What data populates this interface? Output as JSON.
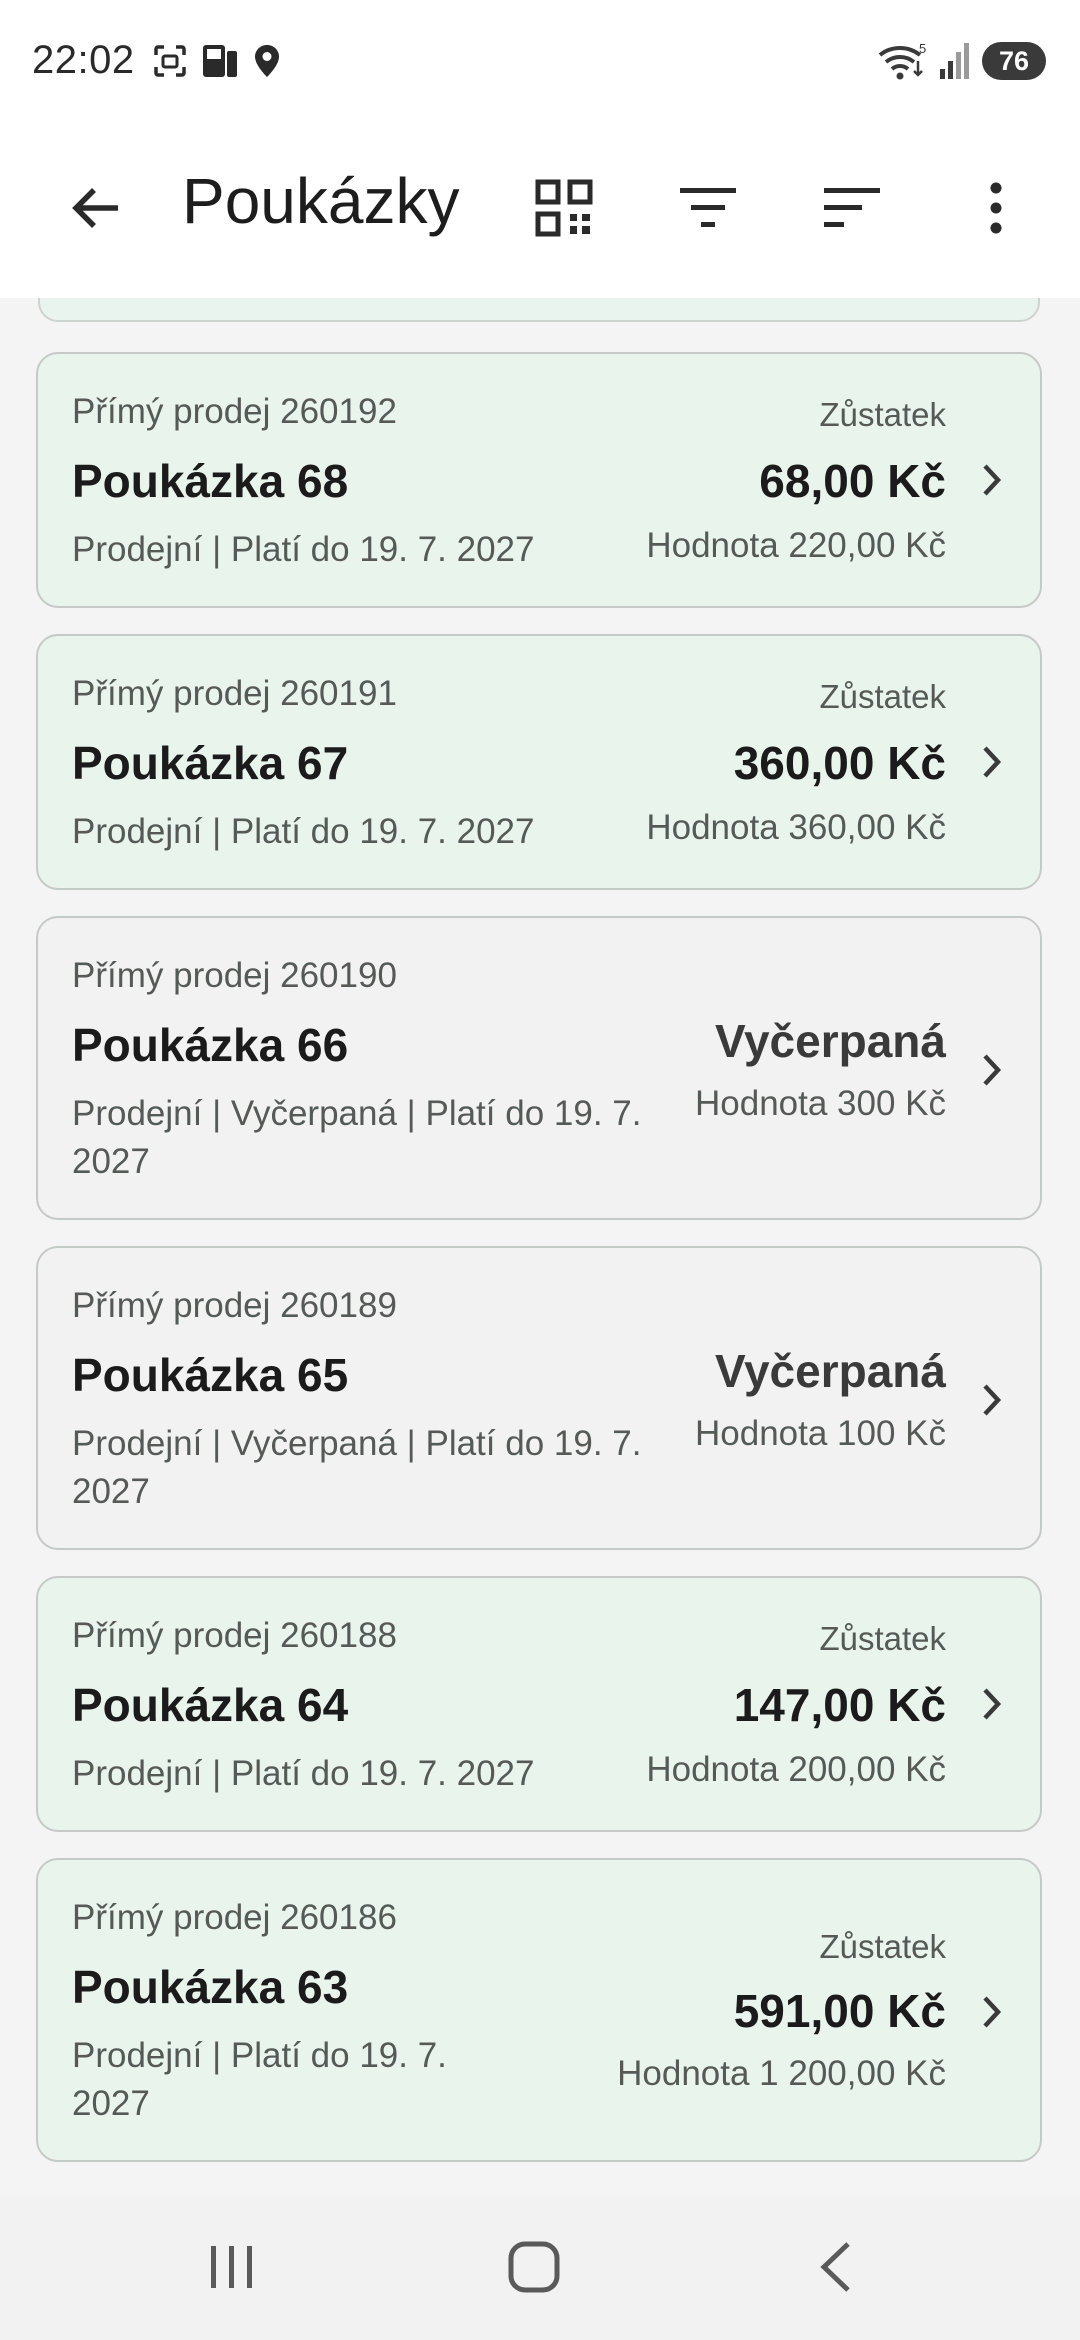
{
  "status_bar": {
    "time": "22:02",
    "battery": "76",
    "wifi_label": "5"
  },
  "app_bar": {
    "title": "Poukázky",
    "icons": [
      "arrow-back-icon",
      "qr-code-icon",
      "filter-icon",
      "sort-icon",
      "more-vert-icon"
    ]
  },
  "vouchers": [
    {
      "source": "Přímý prodej 260192",
      "name": "Poukázka 68",
      "meta": "Prodejní | Platí do 19. 7. 2027",
      "balance_label": "Zůstatek",
      "balance": "68,00 Kč",
      "value": "Hodnota 220,00 Kč",
      "state": "active"
    },
    {
      "source": "Přímý prodej 260191",
      "name": "Poukázka 67",
      "meta": "Prodejní | Platí do 19. 7. 2027",
      "balance_label": "Zůstatek",
      "balance": "360,00 Kč",
      "value": "Hodnota 360,00 Kč",
      "state": "active"
    },
    {
      "source": "Přímý prodej 260190",
      "name": "Poukázka 66",
      "meta": "Prodejní | Vyčerpaná | Platí do 19. 7. 2027",
      "status": "Vyčerpaná",
      "value": "Hodnota 300 Kč",
      "state": "exhausted"
    },
    {
      "source": "Přímý prodej 260189",
      "name": "Poukázka 65",
      "meta": "Prodejní | Vyčerpaná | Platí do 19. 7. 2027",
      "status": "Vyčerpaná",
      "value": "Hodnota 100 Kč",
      "state": "exhausted"
    },
    {
      "source": "Přímý prodej 260188",
      "name": "Poukázka 64",
      "meta": "Prodejní | Platí do 19. 7. 2027",
      "balance_label": "Zůstatek",
      "balance": "147,00 Kč",
      "value": "Hodnota 200,00 Kč",
      "state": "active"
    },
    {
      "source": "Přímý prodej 260186",
      "name": "Poukázka 63",
      "meta": "Prodejní | Platí do 19. 7. 2027",
      "balance_label": "Zůstatek",
      "balance": "591,00 Kč",
      "value": "Hodnota 1 200,00 Kč",
      "state": "active"
    }
  ],
  "colors": {
    "active_card": "#e9f4ec",
    "exhausted_card": "#f2f2f3",
    "border": "#c6cac7",
    "text_primary": "#1b1b1b",
    "text_secondary": "#555a57"
  },
  "nav_bar": {
    "icons": [
      "recents-icon",
      "home-icon",
      "back-icon"
    ]
  }
}
